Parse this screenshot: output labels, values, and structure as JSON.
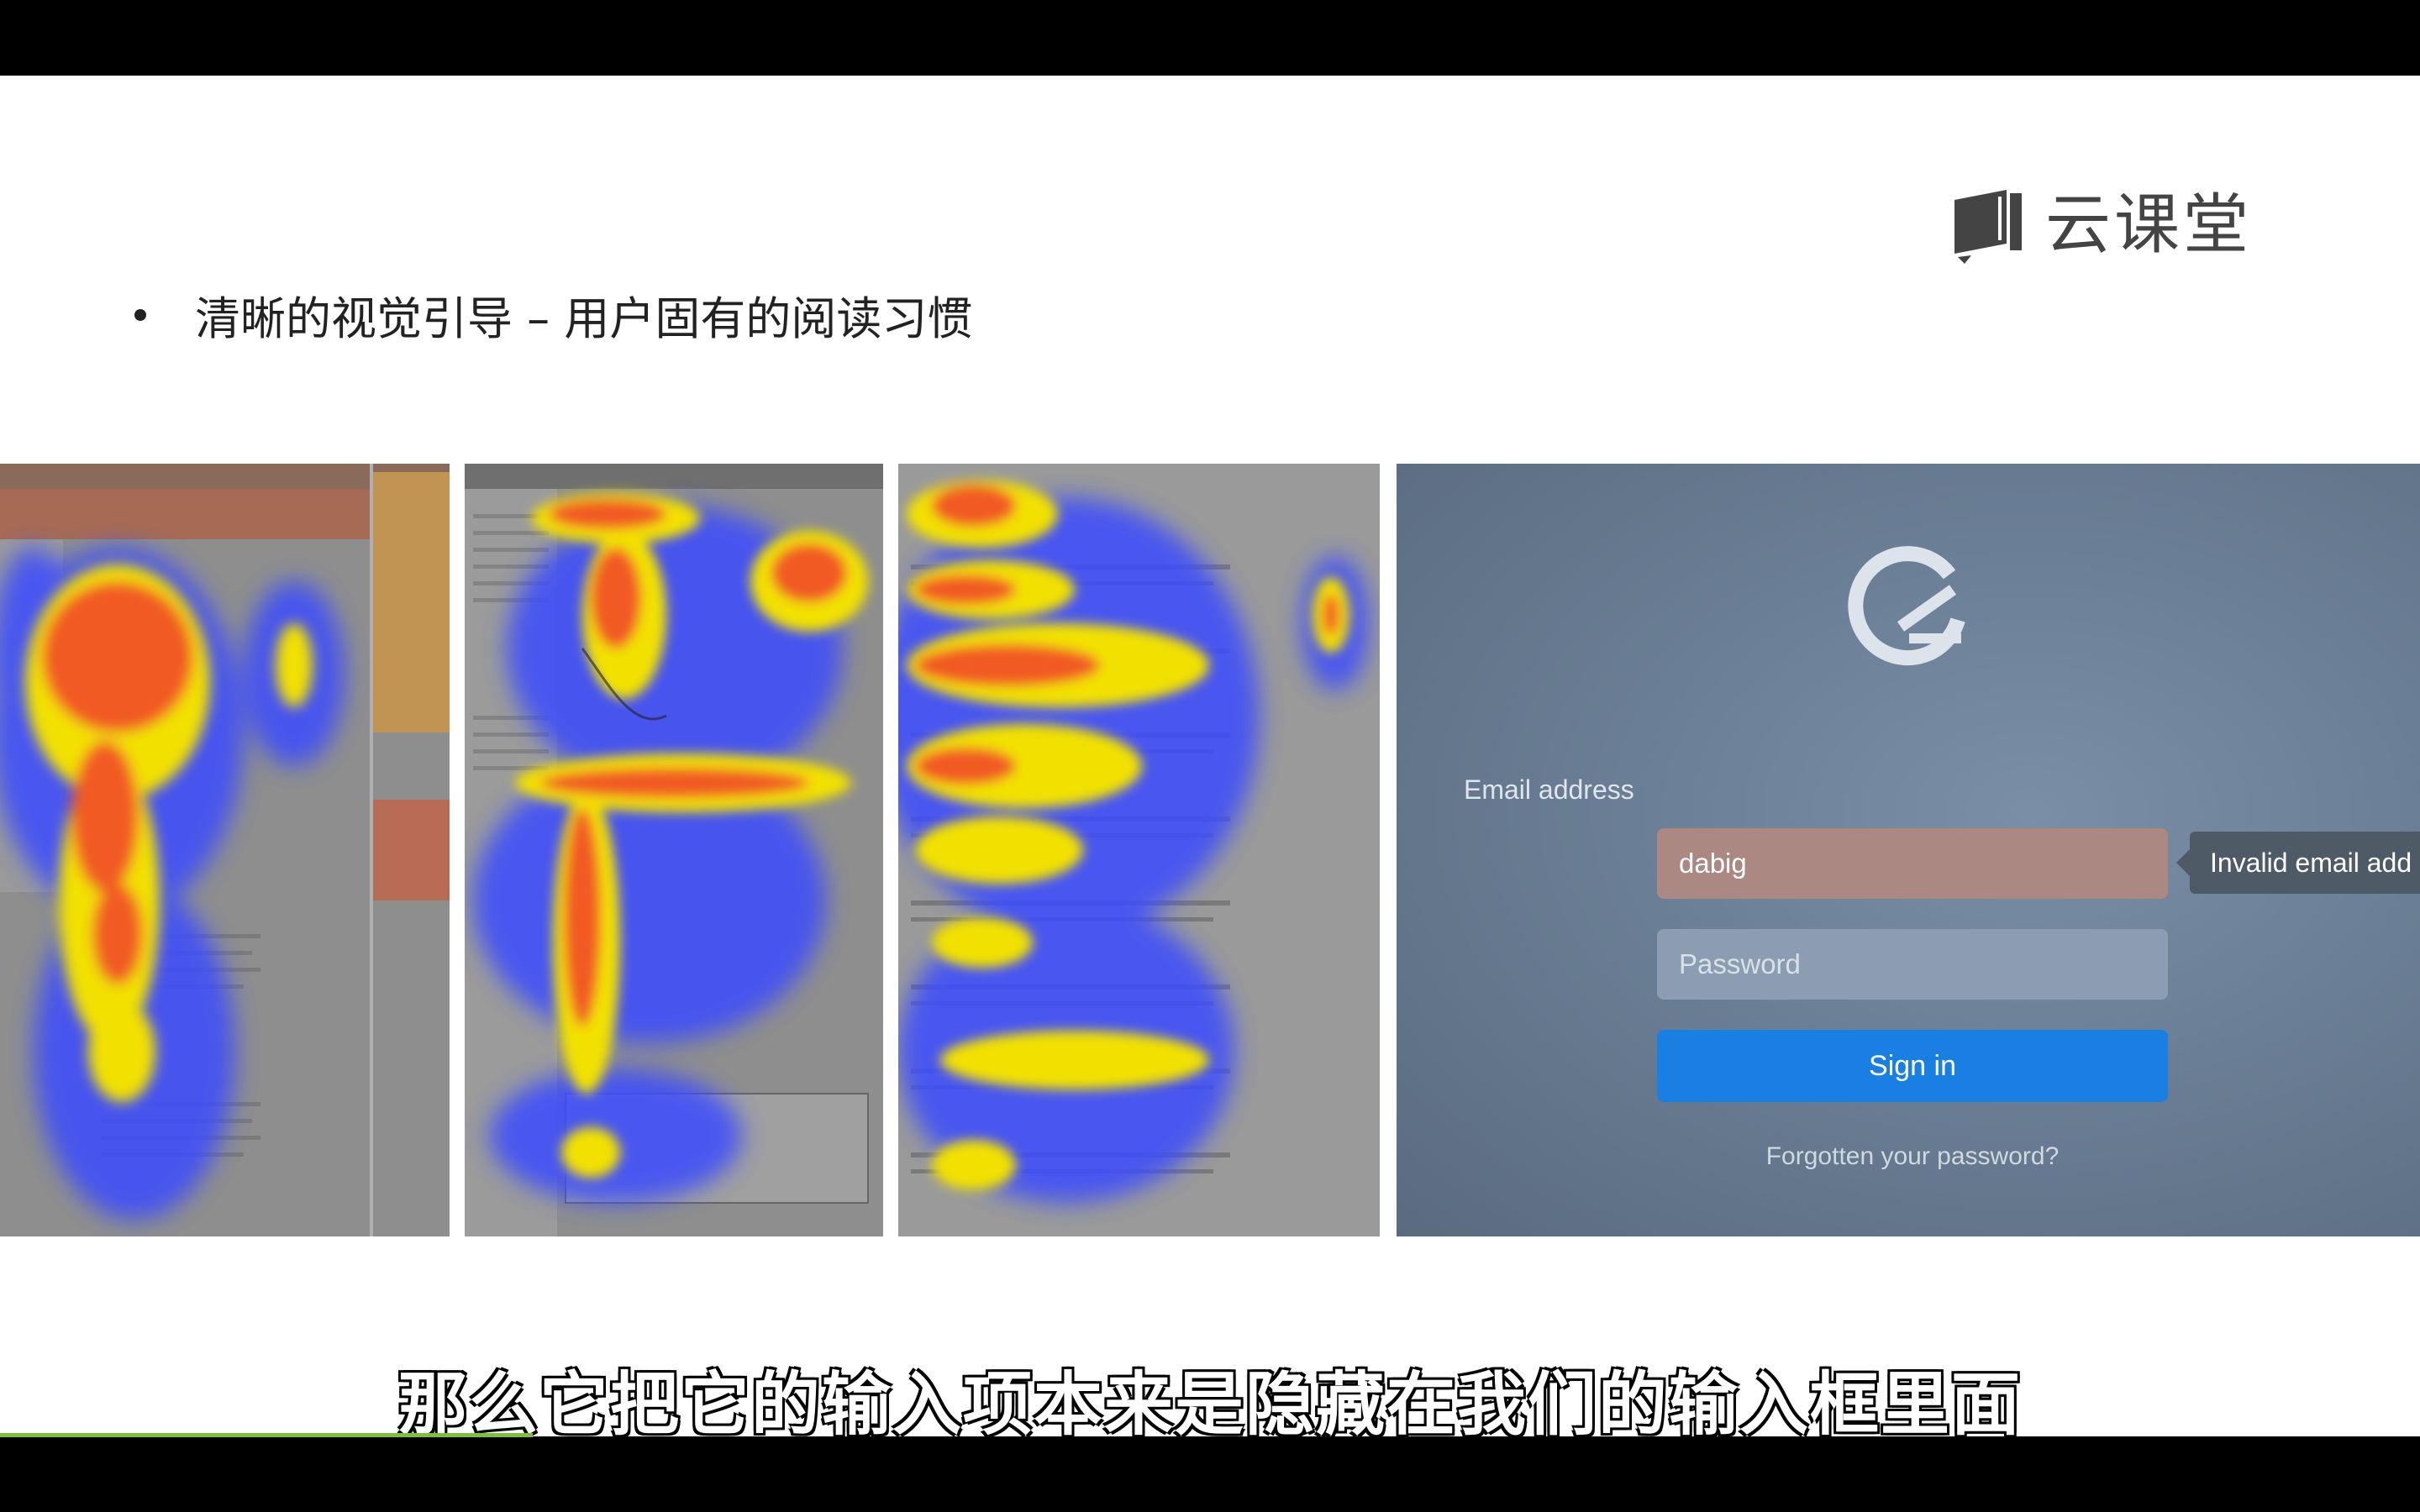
{
  "brand": {
    "name": "云课堂",
    "icon": "book-icon"
  },
  "slide": {
    "bullet": "清晰的视觉引导 – 用户固有的阅读习惯"
  },
  "heatmaps": [
    {
      "name": "heatmap-website-1",
      "icon": "heatmap-image"
    },
    {
      "name": "heatmap-website-2",
      "icon": "heatmap-image"
    },
    {
      "name": "heatmap-google-search",
      "icon": "heatmap-image"
    }
  ],
  "login": {
    "email_label": "Email address",
    "email_value": "dabig",
    "tooltip": "Invalid email add",
    "password_placeholder": "Password",
    "signin_label": "Sign in",
    "forgot_label": "Forgotten your password?",
    "colors": {
      "error_field": "#ab8882",
      "button": "#1a7fe3"
    }
  },
  "subtitle": "那么它把它的输入项本来是隐藏在我们的输入框里面",
  "progress": {
    "fraction": 0.22,
    "color": "#7fbf3c"
  }
}
